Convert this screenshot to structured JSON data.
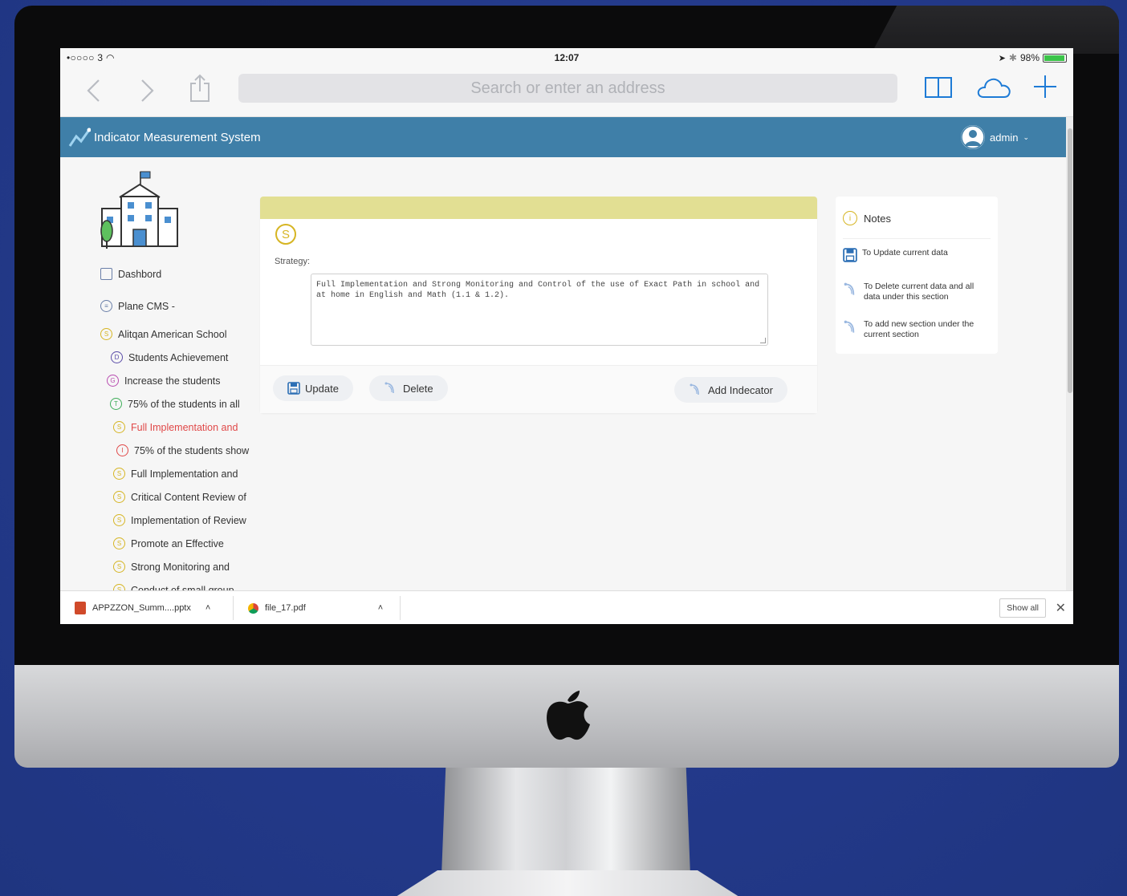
{
  "status_bar": {
    "carrier": "•○○○○ 3",
    "time": "12:07",
    "battery": "98%",
    "battery_level": 0.98
  },
  "browser": {
    "url_placeholder": "Search or enter an address",
    "icons": [
      "back-icon",
      "forward-icon",
      "share-icon",
      "bookmarks-icon",
      "cloud-icon",
      "new-tab-icon"
    ]
  },
  "header": {
    "title": "Indicator Measurement System",
    "user": "admin"
  },
  "sidebar": {
    "items": [
      {
        "label": "Dashbord",
        "color": "#6a7fa8"
      },
      {
        "label": "Plane CMS  -",
        "color": "#6a7fa8"
      },
      {
        "label": "Alitqan American School",
        "color": "#d6b523"
      },
      {
        "label": "Students Achievement",
        "color": "#5a4ca8"
      },
      {
        "label": "Increase the students",
        "color": "#b84cb0"
      },
      {
        "label": "75% of the students in all",
        "color": "#3fae5a"
      },
      {
        "label": "Full Implementation and",
        "color": "#d6b523",
        "active": true
      },
      {
        "label": "75% of the students show",
        "color": "#e04848"
      },
      {
        "label": "Full Implementation and",
        "color": "#d6b523"
      },
      {
        "label": "Critical Content Review of",
        "color": "#d6b523"
      },
      {
        "label": "Implementation of Review",
        "color": "#d6b523"
      },
      {
        "label": "Promote an Effective",
        "color": "#d6b523"
      },
      {
        "label": "Strong Monitoring and",
        "color": "#d6b523"
      },
      {
        "label": "Conduct of small group",
        "color": "#d6b523"
      }
    ]
  },
  "main": {
    "strategy_icon": "S",
    "strategy_label": "Strategy:",
    "strategy_text": "Full Implementation and Strong Monitoring and Control of the use of Exact Path in school and at home in English and Math (1.1 & 1.2).",
    "buttons": {
      "update": "Update",
      "delete": "Delete",
      "add_indicator": "Add Indecator"
    },
    "accent_color": "#e2df93"
  },
  "notes": {
    "title": "Notes",
    "items": [
      "To Update current data",
      "To Delete current data and all data under this section",
      "To add new section under the current section"
    ]
  },
  "downloads": {
    "items": [
      {
        "name": "APPZZON_Summ....pptx"
      },
      {
        "name": "file_17.pdf"
      }
    ],
    "show_all": "Show all"
  }
}
